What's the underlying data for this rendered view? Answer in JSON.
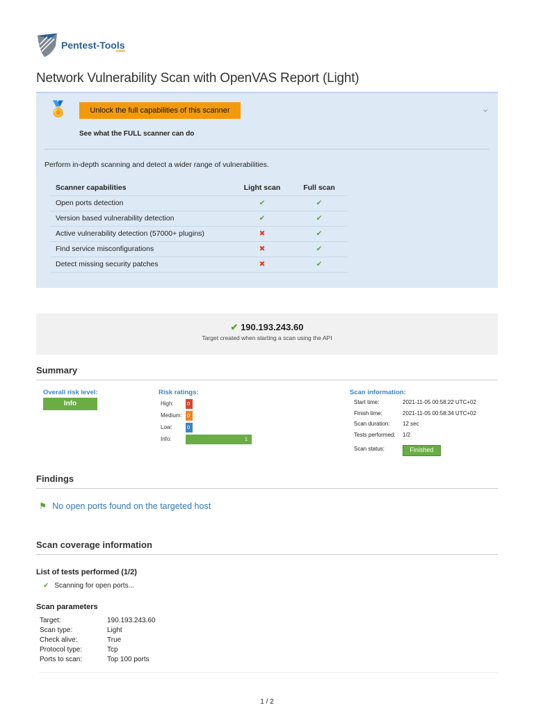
{
  "logo": {
    "name": "Pentest-Tools",
    "suffix": ".com"
  },
  "title": "Network Vulnerability Scan with OpenVAS Report (Light)",
  "promo": {
    "unlock_label": "Unlock the full capabilities of this scanner",
    "see_what": "See what the FULL scanner can do",
    "description": "Perform in-depth scanning and detect a wider range of vulnerabilities.",
    "headers": [
      "Scanner capabilities",
      "Light scan",
      "Full scan"
    ],
    "rows": [
      {
        "name": "Open ports detection",
        "light": "✔",
        "full": "✔"
      },
      {
        "name": "Version based vulnerability detection",
        "light": "✔",
        "full": "✔"
      },
      {
        "name": "Active vulnerability detection (57000+ plugins)",
        "light": "✖",
        "full": "✔"
      },
      {
        "name": "Find service misconfigurations",
        "light": "✖",
        "full": "✔"
      },
      {
        "name": "Detect missing security patches",
        "light": "✖",
        "full": "✔"
      }
    ]
  },
  "target": {
    "ip": "190.193.243.60",
    "subtitle": "Target created when starting a scan using the API"
  },
  "summary": {
    "heading": "Summary",
    "overall_label": "Overall risk level:",
    "overall_value": "Info",
    "risk_label": "Risk ratings:",
    "risks": [
      {
        "label": "High:",
        "value": "0",
        "color": "#d9442f"
      },
      {
        "label": "Medium:",
        "value": "0",
        "color": "#f5841f"
      },
      {
        "label": "Low:",
        "value": "0",
        "color": "#3b86c4"
      },
      {
        "label": "Info:",
        "value": "1",
        "color": "#6aad45"
      }
    ],
    "scan_info_label": "Scan information:",
    "scan_info": [
      {
        "k": "Start time:",
        "v": "2021-11-05 00:58:22 UTC+02"
      },
      {
        "k": "Finish time:",
        "v": "2021-11-05 00:58:34 UTC+02"
      },
      {
        "k": "Scan duration:",
        "v": "12 sec"
      },
      {
        "k": "Tests performed:",
        "v": "1/2"
      }
    ],
    "status_label": "Scan status:",
    "status_value": "Finished"
  },
  "findings": {
    "heading": "Findings",
    "item": "No open ports found on the targeted host"
  },
  "coverage": {
    "heading": "Scan coverage information",
    "tests_heading": "List of tests performed (1/2)",
    "tests": [
      "Scanning for open ports..."
    ],
    "params_heading": "Scan parameters",
    "params": [
      {
        "k": "Target:",
        "v": "190.193.243.60"
      },
      {
        "k": "Scan type:",
        "v": "Light"
      },
      {
        "k": "Check alive:",
        "v": "True"
      },
      {
        "k": "Protocol type:",
        "v": "Tcp"
      },
      {
        "k": "Ports to scan:",
        "v": "Top 100 ports"
      }
    ]
  },
  "page": "1 / 2"
}
